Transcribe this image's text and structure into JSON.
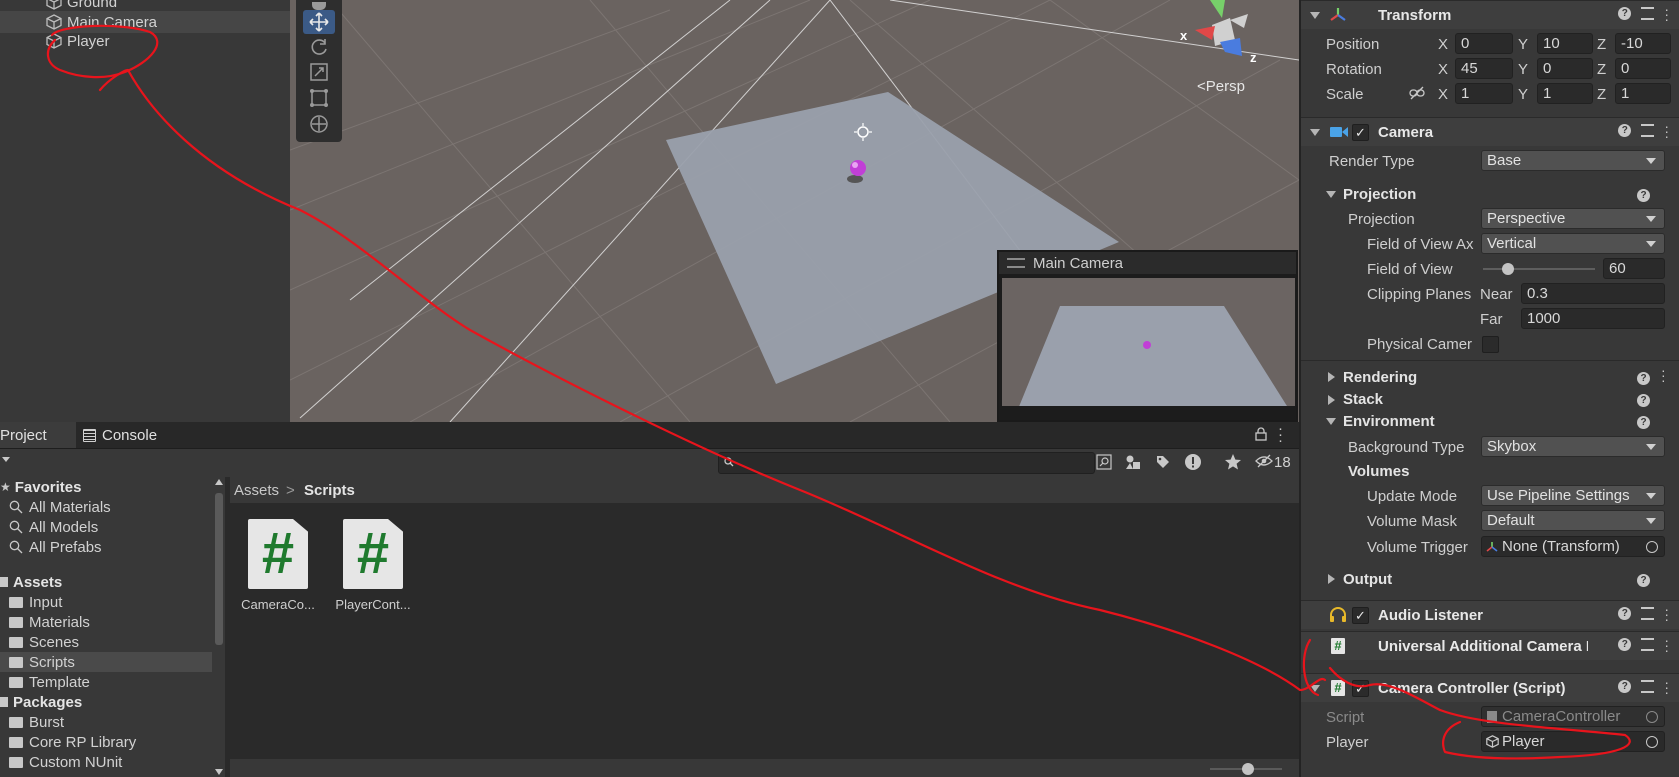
{
  "hierarchy": {
    "items": [
      {
        "label": "Ground"
      },
      {
        "label": "Main Camera"
      },
      {
        "label": "Player"
      }
    ]
  },
  "scene": {
    "persp_label": "<Persp",
    "gizmo_x": "x",
    "gizmo_z": "z",
    "camera_preview_title": "Main Camera"
  },
  "project": {
    "tabs": {
      "project": "Project",
      "console": "Console"
    },
    "badge_count": "18",
    "tree": [
      {
        "label": "Favorites",
        "bold": true
      },
      {
        "label": "All Materials"
      },
      {
        "label": "All Models"
      },
      {
        "label": "All Prefabs"
      },
      {
        "label": "Assets",
        "bold": true
      },
      {
        "label": "Input"
      },
      {
        "label": "Materials"
      },
      {
        "label": "Scenes"
      },
      {
        "label": "Scripts"
      },
      {
        "label": "Template"
      },
      {
        "label": "Packages",
        "bold": true
      },
      {
        "label": "Burst"
      },
      {
        "label": "Core RP Library"
      },
      {
        "label": "Custom NUnit"
      }
    ],
    "breadcrumb": {
      "root": "Assets",
      "sep": ">",
      "current": "Scripts"
    },
    "assets": [
      {
        "glyph": "#",
        "name": "CameraCo..."
      },
      {
        "glyph": "#",
        "name": "PlayerCont..."
      }
    ]
  },
  "inspector": {
    "transform": {
      "title": "Transform",
      "position_label": "Position",
      "rotation_label": "Rotation",
      "scale_label": "Scale",
      "axis": {
        "x": "X",
        "y": "Y",
        "z": "Z"
      },
      "position": {
        "x": "0",
        "y": "10",
        "z": "-10"
      },
      "rotation": {
        "x": "45",
        "y": "0",
        "z": "0"
      },
      "scale": {
        "x": "1",
        "y": "1",
        "z": "1"
      }
    },
    "camera": {
      "title": "Camera",
      "render_type_label": "Render Type",
      "render_type": "Base",
      "projection_header": "Projection",
      "projection_label": "Projection",
      "projection": "Perspective",
      "fov_axis_label": "Field of View Ax",
      "fov_axis": "Vertical",
      "fov_label": "Field of View",
      "fov": "60",
      "fov_fraction": 0.22,
      "clipping_label": "Clipping Planes",
      "near_label": "Near",
      "near": "0.3",
      "far_label": "Far",
      "far": "1000",
      "physical_label": "Physical Camer",
      "rendering_header": "Rendering",
      "stack_header": "Stack",
      "environment_header": "Environment",
      "background_type_label": "Background Type",
      "background_type": "Skybox",
      "volumes_header": "Volumes",
      "update_mode_label": "Update Mode",
      "update_mode": "Use Pipeline Settings",
      "volume_mask_label": "Volume Mask",
      "volume_mask": "Default",
      "volume_trigger_label": "Volume Trigger",
      "volume_trigger": "None (Transform)",
      "output_header": "Output"
    },
    "audio_listener": {
      "title": "Audio Listener"
    },
    "universal_camera": {
      "title": "Universal Additional Camera I"
    },
    "camera_controller": {
      "title": "Camera Controller (Script)",
      "script_label": "Script",
      "script_value": "CameraController",
      "player_label": "Player",
      "player_value": "Player"
    }
  },
  "colors": {
    "annotation_red": "#e8141c",
    "selection_blue": "#3b5a86",
    "script_green": "#1f7a2e",
    "player_sphere": "#c13fd6"
  }
}
